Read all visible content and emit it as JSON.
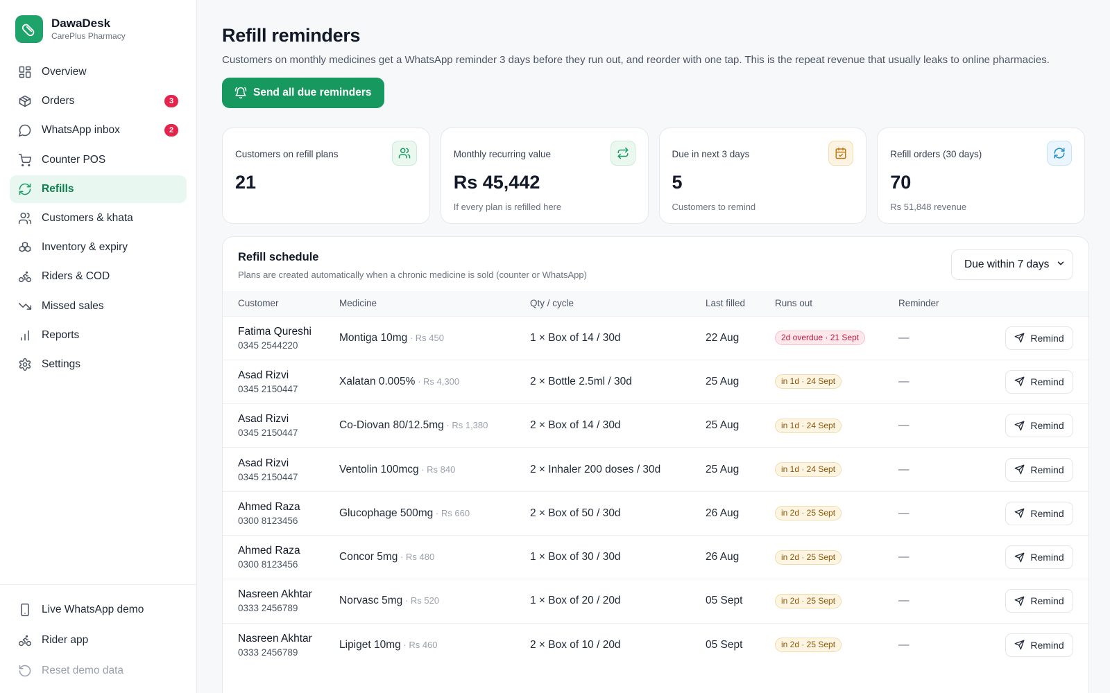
{
  "brand": {
    "name": "DawaDesk",
    "sub": "CarePlus Pharmacy"
  },
  "nav": [
    {
      "label": "Overview",
      "icon": "grid-icon"
    },
    {
      "label": "Orders",
      "icon": "box-icon",
      "badge": "3"
    },
    {
      "label": "WhatsApp inbox",
      "icon": "chat-icon",
      "badge": "2"
    },
    {
      "label": "Counter POS",
      "icon": "cart-icon"
    },
    {
      "label": "Refills",
      "icon": "refresh-icon",
      "active": true
    },
    {
      "label": "Customers & khata",
      "icon": "users-icon"
    },
    {
      "label": "Inventory & expiry",
      "icon": "boxes-icon"
    },
    {
      "label": "Riders & COD",
      "icon": "bike-icon"
    },
    {
      "label": "Missed sales",
      "icon": "trend-down-icon"
    },
    {
      "label": "Reports",
      "icon": "bar-chart-icon"
    },
    {
      "label": "Settings",
      "icon": "gear-icon"
    }
  ],
  "footer": [
    {
      "label": "Live WhatsApp demo",
      "icon": "phone-icon"
    },
    {
      "label": "Rider app",
      "icon": "bike-icon"
    },
    {
      "label": "Reset demo data",
      "icon": "reset-icon"
    }
  ],
  "page": {
    "title": "Refill reminders",
    "description": "Customers on monthly medicines get a WhatsApp reminder 3 days before they run out, and reorder with one tap. This is the repeat revenue that usually leaks to online pharmacies.",
    "primary_button": "Send all due reminders"
  },
  "stats": [
    {
      "label": "Customers on refill plans",
      "value": "21",
      "sub": "",
      "icon": "users-icon",
      "tone": "green"
    },
    {
      "label": "Monthly recurring value",
      "value": "Rs 45,442",
      "sub": "If every plan is refilled here",
      "icon": "repeat-icon",
      "tone": "green"
    },
    {
      "label": "Due in next 3 days",
      "value": "5",
      "sub": "Customers to remind",
      "icon": "calendar-icon",
      "tone": "amber"
    },
    {
      "label": "Refill orders (30 days)",
      "value": "70",
      "sub": "Rs 51,848 revenue",
      "icon": "refresh-icon",
      "tone": "blue"
    }
  ],
  "schedule": {
    "title": "Refill schedule",
    "subtitle": "Plans are created automatically when a chronic medicine is sold (counter or WhatsApp)",
    "filter": "Due within 7 days",
    "columns": [
      "Customer",
      "Medicine",
      "Qty / cycle",
      "Last filled",
      "Runs out",
      "Reminder"
    ],
    "action_label": "Remind",
    "rows": [
      {
        "name": "Fatima Qureshi",
        "phone": "0345 2544220",
        "medicine": "Montiga 10mg",
        "price": "Rs 450",
        "qty": "1 × Box of 14 / 30d",
        "last": "22 Aug",
        "runs": "2d overdue · 21 Sept",
        "status": "overdue",
        "reminder": "—"
      },
      {
        "name": "Asad Rizvi",
        "phone": "0345 2150447",
        "medicine": "Xalatan 0.005%",
        "price": "Rs 4,300",
        "qty": "2 × Bottle 2.5ml / 30d",
        "last": "25 Aug",
        "runs": "in 1d · 24 Sept",
        "status": "soon",
        "reminder": "—"
      },
      {
        "name": "Asad Rizvi",
        "phone": "0345 2150447",
        "medicine": "Co-Diovan 80/12.5mg",
        "price": "Rs 1,380",
        "qty": "2 × Box of 14 / 30d",
        "last": "25 Aug",
        "runs": "in 1d · 24 Sept",
        "status": "soon",
        "reminder": "—"
      },
      {
        "name": "Asad Rizvi",
        "phone": "0345 2150447",
        "medicine": "Ventolin 100mcg",
        "price": "Rs 840",
        "qty": "2 × Inhaler 200 doses / 30d",
        "last": "25 Aug",
        "runs": "in 1d · 24 Sept",
        "status": "soon",
        "reminder": "—"
      },
      {
        "name": "Ahmed Raza",
        "phone": "0300 8123456",
        "medicine": "Glucophage 500mg",
        "price": "Rs 660",
        "qty": "2 × Box of 50 / 30d",
        "last": "26 Aug",
        "runs": "in 2d · 25 Sept",
        "status": "soon",
        "reminder": "—"
      },
      {
        "name": "Ahmed Raza",
        "phone": "0300 8123456",
        "medicine": "Concor 5mg",
        "price": "Rs 480",
        "qty": "1 × Box of 30 / 30d",
        "last": "26 Aug",
        "runs": "in 2d · 25 Sept",
        "status": "soon",
        "reminder": "—"
      },
      {
        "name": "Nasreen Akhtar",
        "phone": "0333 2456789",
        "medicine": "Norvasc 5mg",
        "price": "Rs 520",
        "qty": "1 × Box of 20 / 20d",
        "last": "05 Sept",
        "runs": "in 2d · 25 Sept",
        "status": "soon",
        "reminder": "—"
      },
      {
        "name": "Nasreen Akhtar",
        "phone": "0333 2456789",
        "medicine": "Lipiget 10mg",
        "price": "Rs 460",
        "qty": "2 × Box of 10 / 20d",
        "last": "05 Sept",
        "runs": "in 2d · 25 Sept",
        "status": "soon",
        "reminder": "—"
      }
    ]
  }
}
